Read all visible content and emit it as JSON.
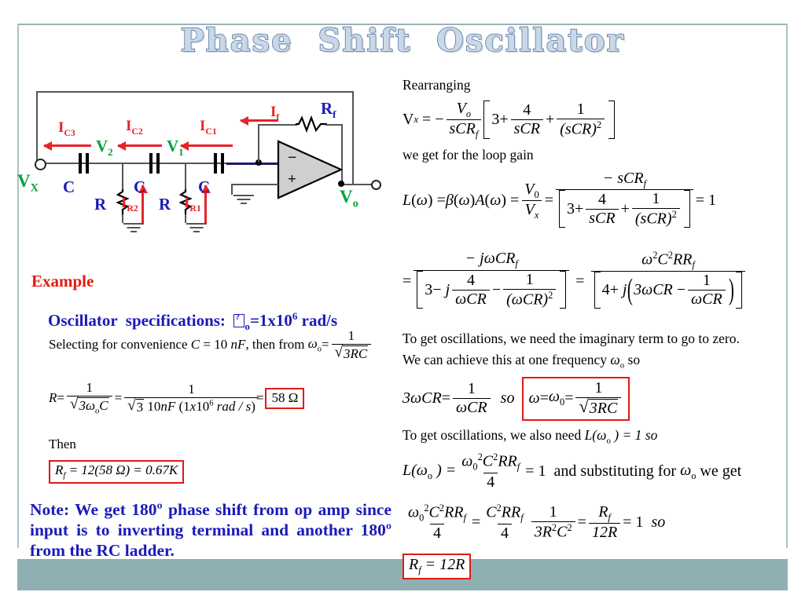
{
  "slide": {
    "title": "Phase  Shift  Oscillator",
    "footer_color": "#8FB0B2",
    "accent_red": "#E01B12",
    "accent_blue": "#1A1AB8",
    "accent_green": "#00A43C"
  },
  "circuit": {
    "name": "rc-phase-shift-oscillator",
    "node_labels": {
      "vx": "V",
      "vx_sub": "X",
      "v1": "V",
      "v1_sub": "1",
      "v2": "V",
      "v2_sub": "2",
      "vo": "V",
      "vo_sub": "o"
    },
    "currents": [
      {
        "base": "I",
        "sub": "C3"
      },
      {
        "base": "I",
        "sub": "C2"
      },
      {
        "base": "I",
        "sub": "C1"
      },
      {
        "base": "I",
        "sub": "f"
      },
      {
        "base": "I",
        "sub": "R2"
      },
      {
        "base": "I",
        "sub": "R1"
      }
    ],
    "components": {
      "cap_label": "C",
      "res_label": "R",
      "feedback_res": "R",
      "feedback_res_sub": "f"
    },
    "opamp": {
      "inverting": "−",
      "noninverting": "+"
    }
  },
  "right": {
    "rearranging": "Rearranging",
    "loop_gain_intro": "we  get  for  the  loop  gain",
    "imaginary_note": "To get oscillations, we need the imaginary term to go to zero.",
    "one_frequency": "We  can  achieve  this  at  one  frequency",
    "one_frequency_tail": "so",
    "omega": "ω",
    "omega_sub_o": "o",
    "omega_sub_0": "0",
    "so": "so",
    "also_need_pre": "To  get  oscillations,  we  also  need",
    "also_need_eq": "L(ω",
    "also_need_eq2": ") = 1",
    "and_substituting": "and  substituting  for",
    "we_get": "we  get",
    "boxed_omega0": "ω = ω",
    "boxed_rf": "R",
    "boxed_rf_sub": "f",
    "boxed_rf_val": " = 12R",
    "terms": {
      "three": "3",
      "four": "4",
      "one": "1",
      "sCR": "sCR",
      "sCRf": "sCR",
      "f": "f",
      "omegaCR": "ωCR",
      "RRf": "RR",
      "C2": "C",
      "twelveR": "12R",
      "3R2C2": "3R",
      "sqrt3RC": "3RC"
    }
  },
  "left": {
    "example_heading": "Example",
    "spec_prefix": "Oscillator  specifications:  ",
    "spec_value": "=1x10",
    "spec_exp": "6",
    "spec_unit": " rad/s",
    "selecting": "Selecting  for  convenience",
    "selecting_c": "C",
    "selecting_val": "= 10",
    "selecting_unit": "nF",
    "then_from": "then  from",
    "r_value_boxed": "58  Ω",
    "then": "Then",
    "rf_boxed": "= 12(58  Ω) = 0.67K",
    "note": "Note: We get 180º phase shift from op amp since input is to inverting terminal and another 180º from the RC ladder.",
    "nF": "10nF",
    "radps": "rad / s",
    "onex10": "(1x10",
    "six": "6",
    "closep": ")"
  }
}
